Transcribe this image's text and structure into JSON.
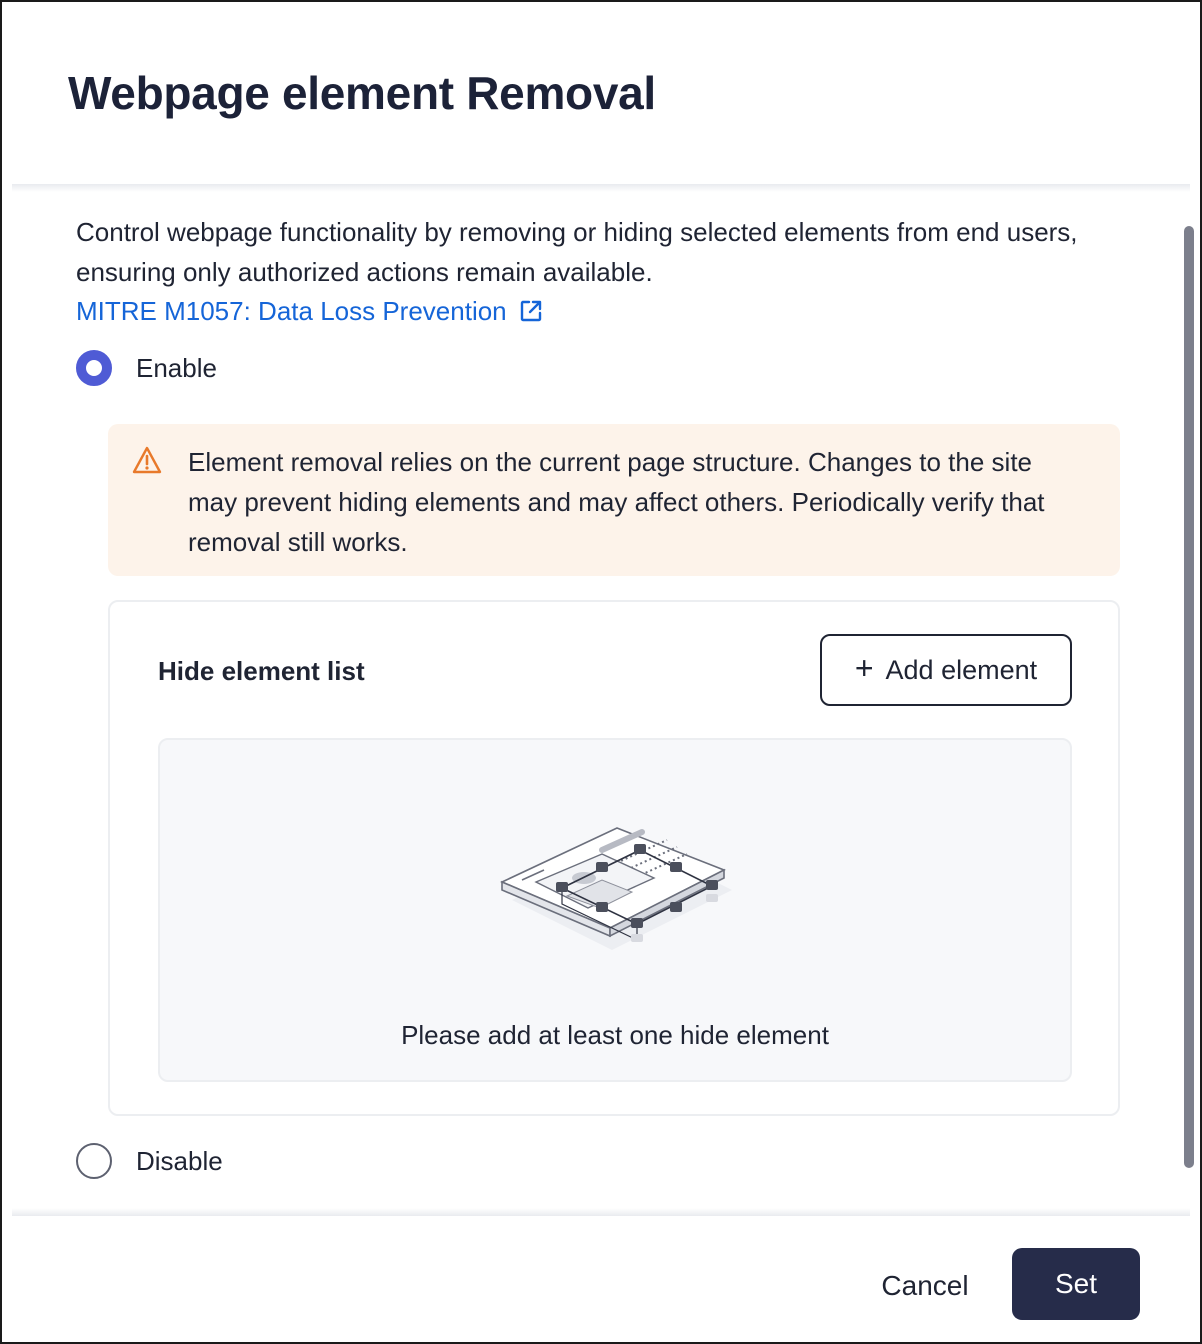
{
  "dialog": {
    "title": "Webpage element Removal",
    "description": "Control webpage functionality by removing or hiding selected elements from end users, ensuring only authorized actions remain available.",
    "link_text": "MITRE M1057: Data Loss Prevention",
    "link_icon": "external-link-icon"
  },
  "options": {
    "enable_label": "Enable",
    "disable_label": "Disable",
    "selected": "Enable"
  },
  "warning": {
    "icon": "warning-triangle-icon",
    "text": "Element removal relies on the current page structure. Changes to the site may prevent hiding elements and may affect others. Periodically verify that removal still works."
  },
  "hide_list": {
    "title": "Hide element list",
    "add_button_label": "Add element",
    "empty_message": "Please add at least one hide element"
  },
  "footer": {
    "cancel_label": "Cancel",
    "set_label": "Set"
  },
  "colors": {
    "accent": "#4f5bd5",
    "link": "#1565d8",
    "primary_button": "#262c4a",
    "warning_bg": "#fdf3ea",
    "warning_icon": "#e8792b"
  }
}
